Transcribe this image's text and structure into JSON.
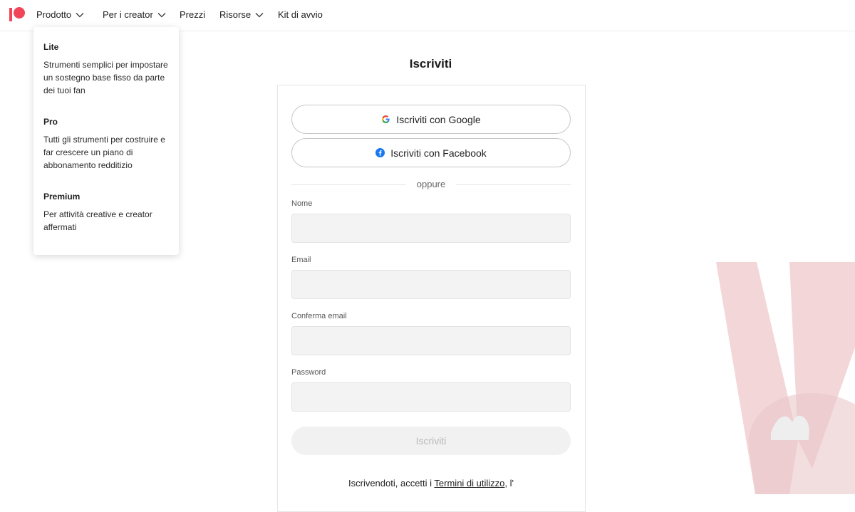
{
  "nav": {
    "items": [
      {
        "label": "Prodotto",
        "dropdown": true
      },
      {
        "label": "Per i creator",
        "dropdown": true
      },
      {
        "label": "Prezzi",
        "dropdown": false
      },
      {
        "label": "Risorse",
        "dropdown": true
      },
      {
        "label": "Kit di avvio",
        "dropdown": false
      }
    ]
  },
  "dropdown": {
    "items": [
      {
        "title": "Lite",
        "desc": "Strumenti semplici per impostare un sostegno base fisso da parte dei tuoi fan"
      },
      {
        "title": "Pro",
        "desc": "Tutti gli strumenti per costruire e far crescere un piano di abbonamento redditizio"
      },
      {
        "title": "Premium",
        "desc": "Per attività creative e creator affermati"
      }
    ]
  },
  "page": {
    "title": "Iscriviti"
  },
  "form": {
    "google_label": "Iscriviti con Google",
    "facebook_label": "Iscriviti con Facebook",
    "divider": "oppure",
    "fields": {
      "name": {
        "label": "Nome",
        "value": ""
      },
      "email": {
        "label": "Email",
        "value": ""
      },
      "confirm_email": {
        "label": "Conferma email",
        "value": ""
      },
      "password": {
        "label": "Password",
        "value": ""
      }
    },
    "submit_label": "Iscriviti",
    "terms_prefix": "Iscrivendoti, accetti i ",
    "terms_link": "Termini di utilizzo",
    "terms_suffix": ", l'"
  },
  "colors": {
    "brand": "#f1465a",
    "facebook": "#1877f2",
    "field_bg": "#f3f3f3"
  },
  "icons": [
    "chevron-down-icon",
    "google-icon",
    "facebook-icon",
    "patreon-logo"
  ]
}
